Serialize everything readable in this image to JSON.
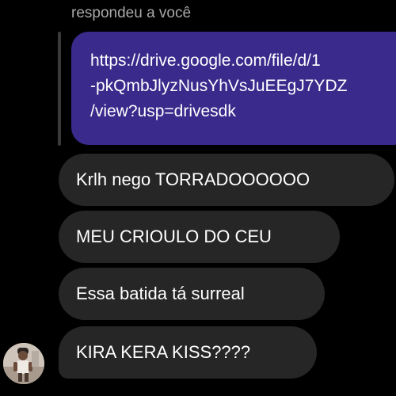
{
  "reply": {
    "header": "respondeu a você",
    "quoted_lines": [
      "https://drive.google.com/file/d/1",
      "-pkQmbJlyzNusYhVsJuEEgJ7YDZ",
      "/view?usp=drivesdk"
    ]
  },
  "messages": [
    "Krlh nego TORRADOOOOOO",
    "MEU CRIOULO DO CEU",
    "Essa batida tá surreal",
    "KIRA KERA KISS????"
  ],
  "colors": {
    "background": "#000000",
    "quoted_bubble": "#3a2a8c",
    "message_bubble": "#262626",
    "header_text": "#a8a8a8"
  }
}
